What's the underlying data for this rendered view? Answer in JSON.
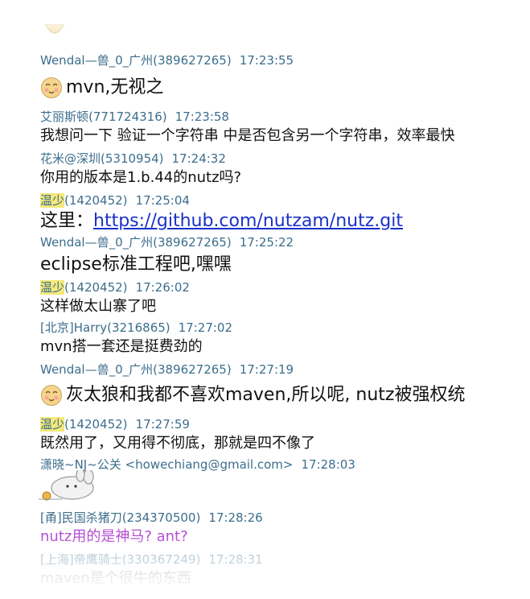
{
  "messages": [
    {
      "sender": "Wendal—兽_0_广州(389627265)",
      "time": "17:23:55",
      "text": "mvn,无视之",
      "emoji": "smiley-face-icon"
    },
    {
      "sender": "艾丽斯顿(771724316)",
      "time": "17:23:58",
      "text": "我想问一下 验证一个字符串 中是否包含另一个字符串，效率最快"
    },
    {
      "sender": "花米@深圳(5310954)",
      "time": "17:24:32",
      "text": "你用的版本是1.b.44的nutz吗?"
    },
    {
      "sender_hl": "温少",
      "sender": "(1420452)",
      "time": "17:25:04",
      "text": "这里：",
      "link": "https://github.com/nutzam/nutz.git"
    },
    {
      "sender": "Wendal—兽_0_广州(389627265)",
      "time": "17:25:22",
      "text": "eclipse标准工程吧,嘿嘿"
    },
    {
      "sender_hl": "温少",
      "sender": "(1420452)",
      "time": "17:26:02",
      "text": "这样做太山寨了吧"
    },
    {
      "sender": "[北京]Harry(3216865)",
      "time": "17:27:02",
      "text": "mvn搭一套还是挺费劲的"
    },
    {
      "sender": "Wendal—兽_0_广州(389627265)",
      "time": "17:27:19",
      "text": "灰太狼和我都不喜欢maven,所以呢, nutz被强权统",
      "emoji": "smiley-face-icon"
    },
    {
      "sender_hl": "温少",
      "sender": "(1420452)",
      "time": "17:27:59",
      "text": "既然用了，又用得不彻底，那就是四不像了"
    },
    {
      "sender": "潇晓~NJ~公关 <howechiang@gmail.com>",
      "time": "17:28:03",
      "sticker": "bunny-sticker-icon"
    },
    {
      "sender": "[甬]民国杀猪刀(234370500)",
      "time": "17:28:26",
      "text": "nutz用的是神马? ant?",
      "color": "#b34ad1"
    },
    {
      "sender": "[上海]帝鹰骑士(330367249)",
      "time": "17:28:31",
      "text": "maven是个很牛的东西"
    }
  ]
}
